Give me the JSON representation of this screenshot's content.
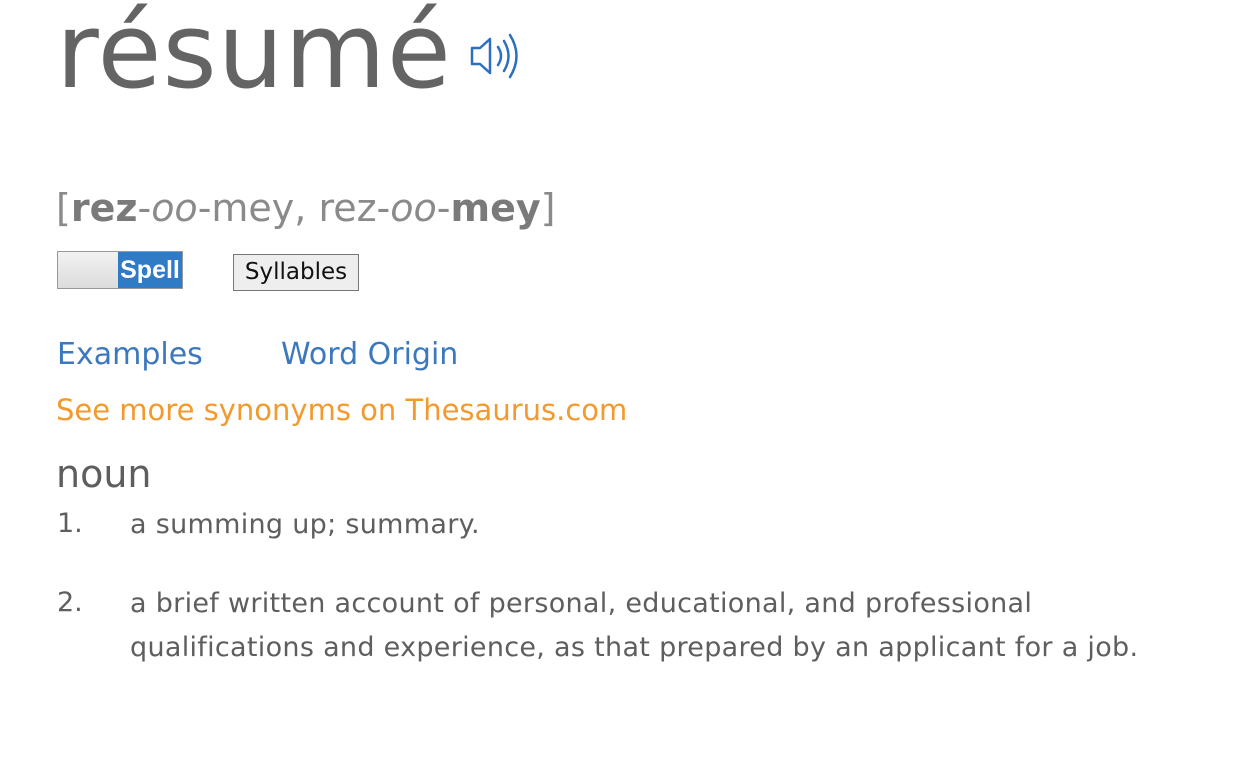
{
  "entry": {
    "headword": "résumé",
    "audio_icon": "speaker-icon"
  },
  "pronunciation": {
    "open_bracket": "[",
    "p1_bold": "rez",
    "p1_dash1": "-",
    "p1_ital": "oo",
    "p1_rest": "-mey, rez-",
    "p2_ital": "oo",
    "p2_dash": "-",
    "p2_bold": "mey",
    "close_bracket": "]"
  },
  "controls": {
    "spell_label": "Spell",
    "syllables_label": "Syllables"
  },
  "links": {
    "examples": "Examples",
    "word_origin": "Word Origin",
    "thesaurus": "See more synonyms on Thesaurus.com"
  },
  "definitions": {
    "part_of_speech": "noun",
    "items": [
      {
        "num": "1.",
        "text": "a summing up; summary."
      },
      {
        "num": "2.",
        "text": "a brief written account of personal, educational, and professional qualifications and experience, as that prepared by an applicant for a job."
      }
    ]
  },
  "colors": {
    "link_blue": "#3b78bd",
    "thesaurus_orange": "#f39a2f",
    "toggle_blue": "#2f7bc6"
  }
}
